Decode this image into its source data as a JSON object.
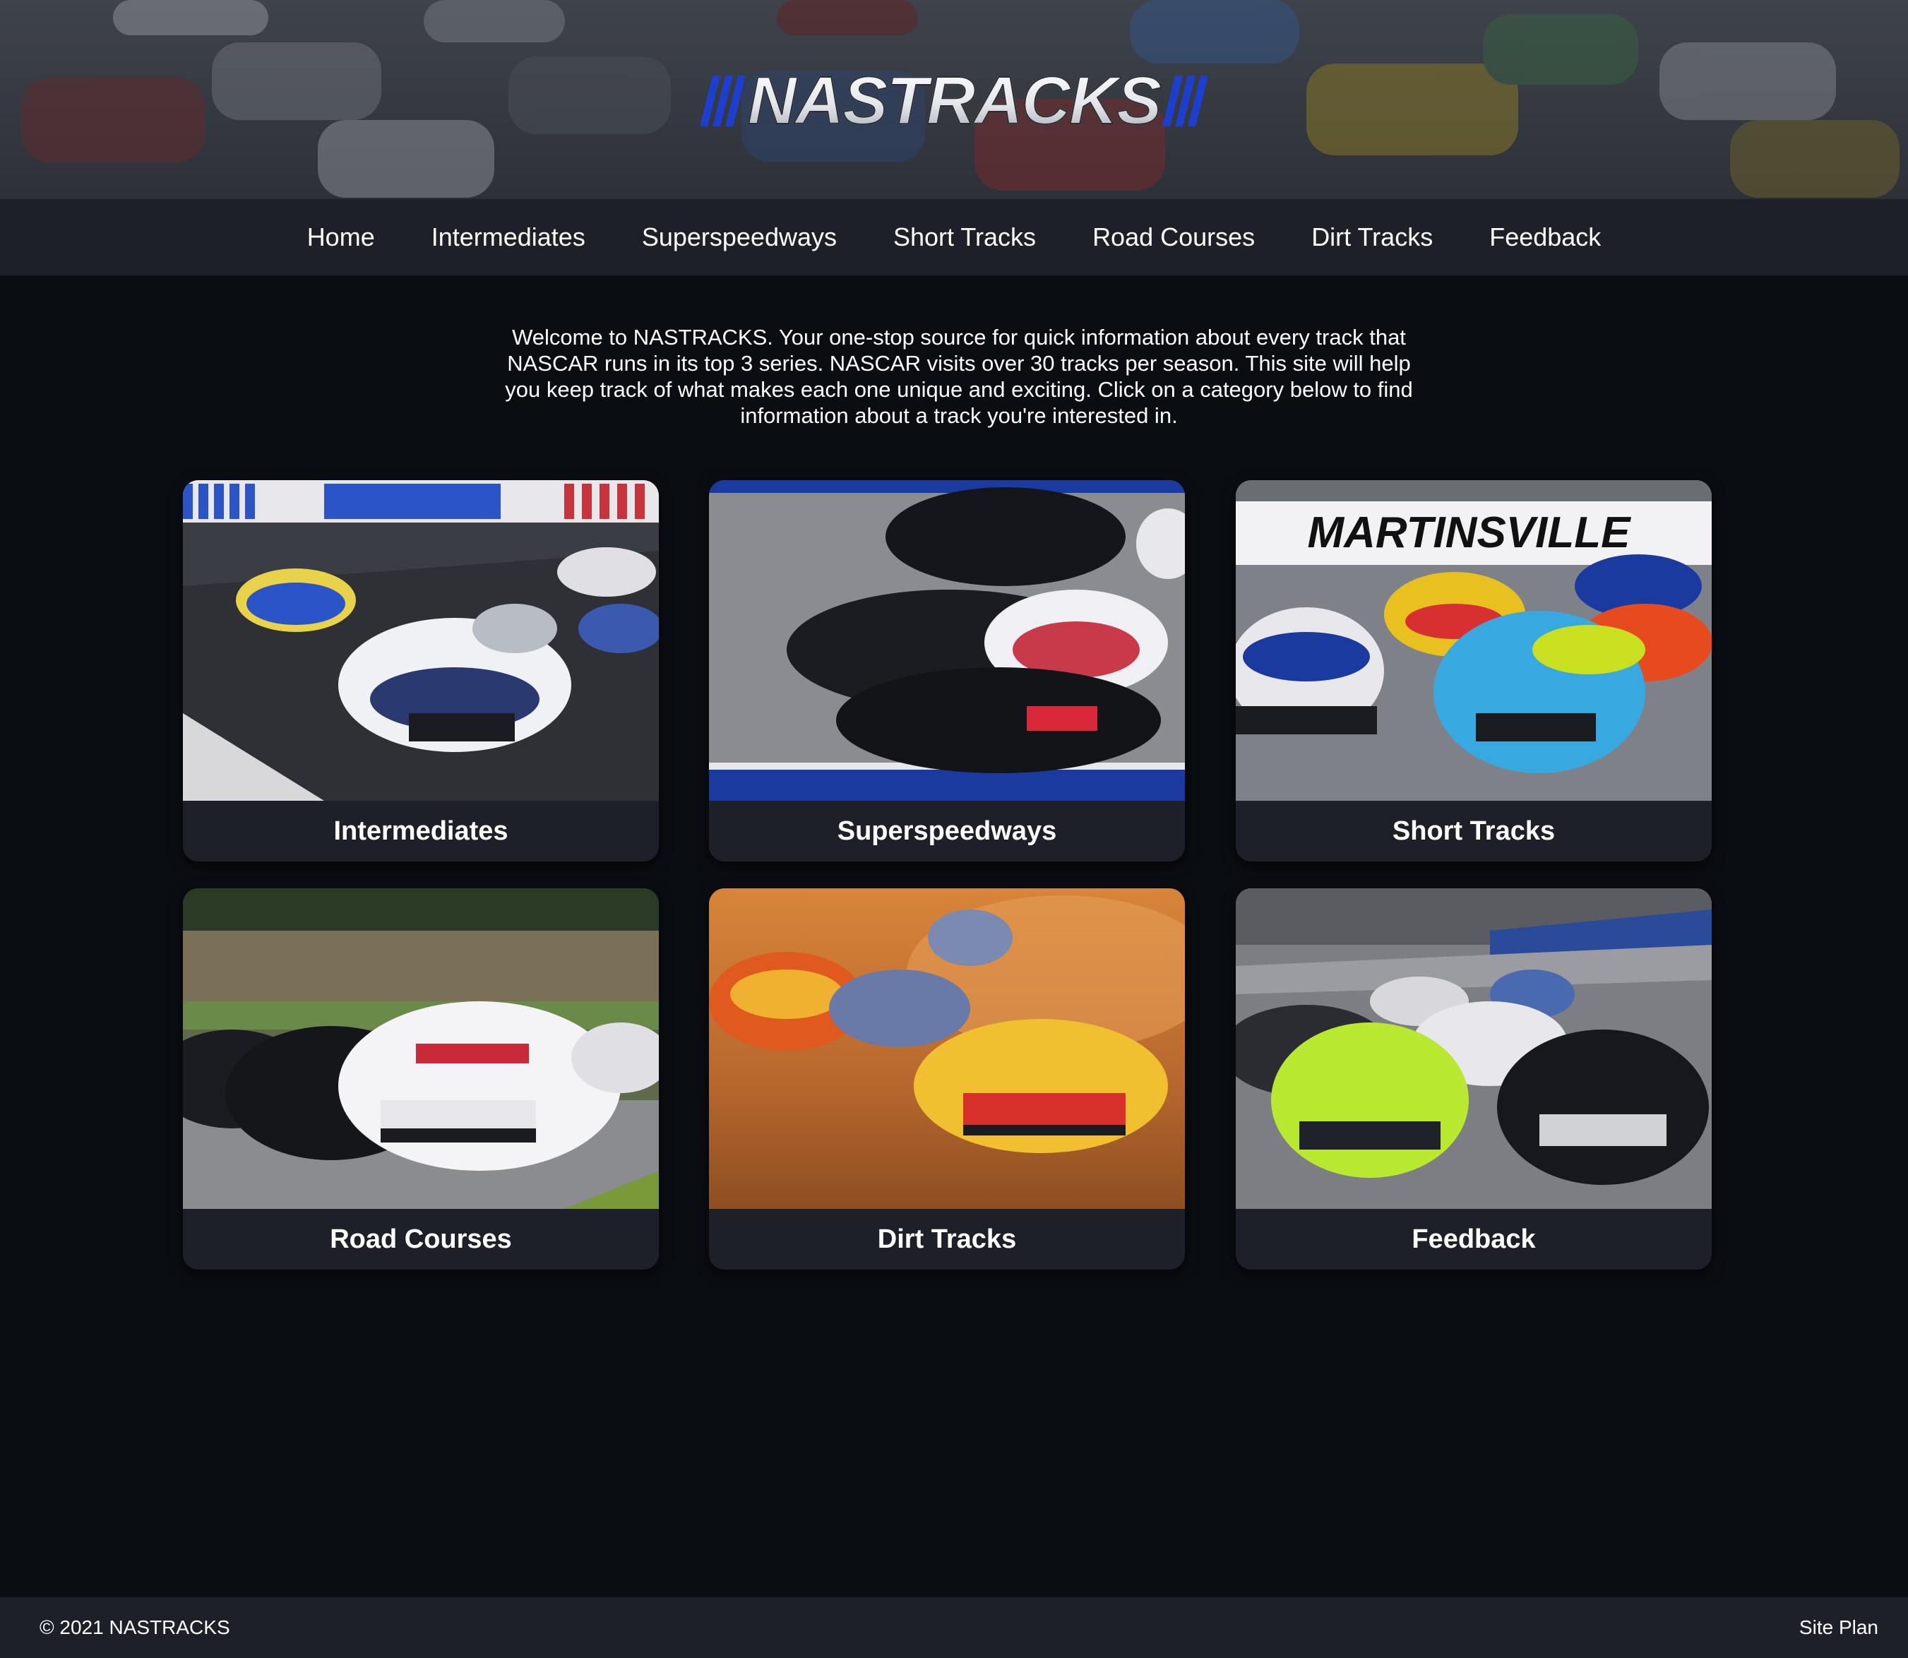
{
  "site": {
    "logo_text": "NASTRACKS"
  },
  "nav": {
    "items": [
      {
        "label": "Home"
      },
      {
        "label": "Intermediates"
      },
      {
        "label": "Superspeedways"
      },
      {
        "label": "Short Tracks"
      },
      {
        "label": "Road Courses"
      },
      {
        "label": "Dirt Tracks"
      },
      {
        "label": "Feedback"
      }
    ]
  },
  "intro": {
    "text": "Welcome to NASTRACKS. Your one-stop source for quick information about every track that NASCAR runs in its top 3 series. NASCAR visits over 30 tracks per season. This site will help you keep track of what makes each one unique and exciting. Click on a category below to find information about a track you're interested in."
  },
  "cards": [
    {
      "label": "Intermediates",
      "image_sign": ""
    },
    {
      "label": "Superspeedways",
      "image_sign": ""
    },
    {
      "label": "Short Tracks",
      "image_sign": "MARTINSVILLE"
    },
    {
      "label": "Road Courses",
      "image_sign": ""
    },
    {
      "label": "Dirt Tracks",
      "image_sign": ""
    },
    {
      "label": "Feedback",
      "image_sign": ""
    }
  ],
  "footer": {
    "copyright": "© 2021 NASTRACKS",
    "site_plan_label": "Site Plan"
  },
  "colors": {
    "page_bg": "#0a0d12",
    "bar_bg": "#1e2029",
    "logo_accent": "#1d3fd0",
    "text": "#ffffff"
  }
}
